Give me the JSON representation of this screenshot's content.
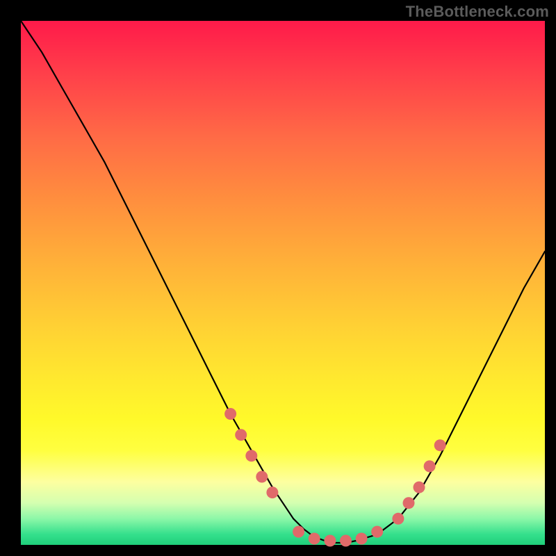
{
  "watermark": "TheBottleneck.com",
  "chart_data": {
    "type": "line",
    "title": "",
    "xlabel": "",
    "ylabel": "",
    "xlim": [
      0,
      100
    ],
    "ylim": [
      0,
      100
    ],
    "grid": false,
    "legend": false,
    "background_gradient": {
      "top_color": "#ff1a4a",
      "mid_color": "#ffe82f",
      "bottom_color": "#1fcf7b"
    },
    "series": [
      {
        "name": "bottleneck-curve",
        "stroke": "#000000",
        "x": [
          0,
          4,
          8,
          12,
          16,
          20,
          24,
          28,
          32,
          36,
          40,
          44,
          48,
          50,
          52,
          54,
          56,
          58,
          60,
          62,
          64,
          68,
          72,
          76,
          80,
          84,
          88,
          92,
          96,
          100
        ],
        "y": [
          100,
          94,
          87,
          80,
          73,
          65,
          57,
          49,
          41,
          33,
          25,
          18,
          11,
          8,
          5,
          3,
          1.5,
          0.8,
          0.4,
          0.4,
          0.8,
          2,
          5,
          10,
          17,
          25,
          33,
          41,
          49,
          56
        ]
      },
      {
        "name": "highlight-dots",
        "stroke": "#e06a6a",
        "type": "scatter",
        "x": [
          40,
          42,
          44,
          46,
          48,
          53,
          56,
          59,
          62,
          65,
          68,
          72,
          74,
          76,
          78,
          80
        ],
        "y": [
          25,
          21,
          17,
          13,
          10,
          2.5,
          1.2,
          0.8,
          0.8,
          1.2,
          2.5,
          5,
          8,
          11,
          15,
          19
        ]
      }
    ],
    "annotations": []
  },
  "colors": {
    "curve": "#000000",
    "dot_fill": "#e06a6a",
    "watermark": "#5b5b5b",
    "frame": "#000000"
  }
}
